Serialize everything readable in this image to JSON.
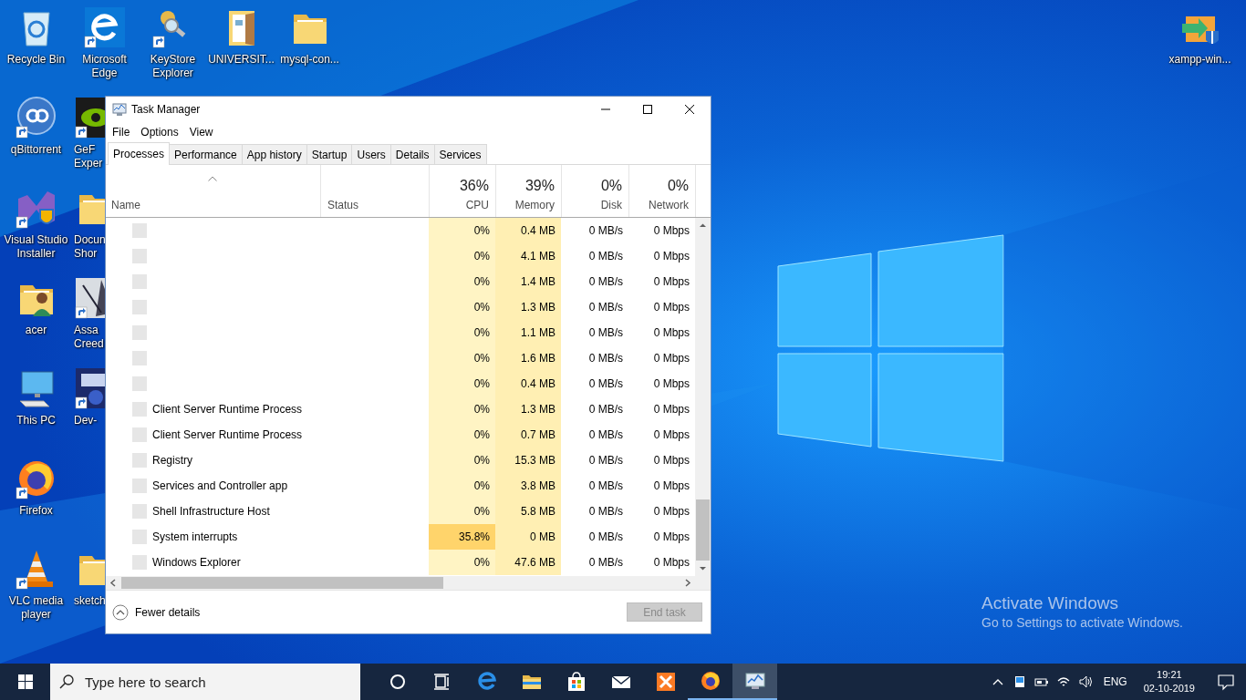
{
  "desktop": {
    "icons": [
      {
        "label": "Recycle Bin",
        "kind": "recycle-bin",
        "partial": false
      },
      {
        "label": "Microsoft Edge",
        "kind": "edge",
        "partial": false
      },
      {
        "label": "KeyStore Explorer",
        "kind": "keys",
        "partial": false
      },
      {
        "label": "UNIVERSIT...",
        "kind": "docs-folder",
        "partial": false
      },
      {
        "label": "mysql-con...",
        "kind": "folder",
        "partial": false
      },
      {
        "label": "xampp-win...",
        "kind": "xampp",
        "partial": false
      },
      {
        "label": "qBittorrent",
        "kind": "qbittorrent",
        "partial": false
      },
      {
        "label": "GeF Exper",
        "kind": "eye",
        "partial": true
      },
      {
        "label": "Visual Studio Installer",
        "kind": "vs",
        "partial": false
      },
      {
        "label": "Docun Shor",
        "kind": "folder",
        "partial": true
      },
      {
        "label": "acer",
        "kind": "user-folder",
        "partial": false
      },
      {
        "label": "Assa Creed",
        "kind": "game",
        "partial": true
      },
      {
        "label": "This PC",
        "kind": "pc",
        "partial": false
      },
      {
        "label": "Dev-",
        "kind": "devcpp",
        "partial": true
      },
      {
        "label": "Firefox",
        "kind": "firefox",
        "partial": false
      },
      {
        "label": "VLC media player",
        "kind": "vlc",
        "partial": false
      },
      {
        "label": "sketch",
        "kind": "folder",
        "partial": true
      }
    ],
    "activation_notice": {
      "title": "Activate Windows",
      "text": "Go to Settings to activate Windows."
    }
  },
  "task_manager": {
    "title": "Task Manager",
    "menu": [
      "File",
      "Options",
      "View"
    ],
    "tabs": [
      {
        "label": "Processes",
        "selected": true
      },
      {
        "label": "Performance",
        "selected": false
      },
      {
        "label": "App history",
        "selected": false
      },
      {
        "label": "Startup",
        "selected": false
      },
      {
        "label": "Users",
        "selected": false
      },
      {
        "label": "Details",
        "selected": false
      },
      {
        "label": "Services",
        "selected": false
      }
    ],
    "columns": [
      {
        "label": "Name",
        "sorted": true
      },
      {
        "label": "Status",
        "sorted": false
      },
      {
        "label": "CPU",
        "total": "36%",
        "color": "#fff4c4",
        "sorted": false
      },
      {
        "label": "Memory",
        "total": "39%",
        "color": "#ffefb3",
        "sorted": false
      },
      {
        "label": "Disk",
        "total": "0%",
        "color": "#ffffff",
        "sorted": false
      },
      {
        "label": "Network",
        "total": "0%",
        "color": "#ffffff",
        "sorted": false
      }
    ],
    "rows": [
      {
        "cpu": "0%",
        "memory": "0.4 MB",
        "disk": "0 MB/s",
        "network": "0 Mbps",
        "cpu_highlight": false
      },
      {
        "cpu": "0%",
        "memory": "4.1 MB",
        "disk": "0 MB/s",
        "network": "0 Mbps",
        "cpu_highlight": false
      },
      {
        "cpu": "0%",
        "memory": "1.4 MB",
        "disk": "0 MB/s",
        "network": "0 Mbps",
        "cpu_highlight": false
      },
      {
        "cpu": "0%",
        "memory": "1.3 MB",
        "disk": "0 MB/s",
        "network": "0 Mbps",
        "cpu_highlight": false
      },
      {
        "cpu": "0%",
        "memory": "1.1 MB",
        "disk": "0 MB/s",
        "network": "0 Mbps",
        "cpu_highlight": false
      },
      {
        "cpu": "0%",
        "memory": "1.6 MB",
        "disk": "0 MB/s",
        "network": "0 Mbps",
        "cpu_highlight": false
      },
      {
        "cpu": "0%",
        "memory": "0.4 MB",
        "disk": "0 MB/s",
        "network": "0 Mbps",
        "cpu_highlight": false
      },
      {
        "name": "Client Server Runtime Process",
        "cpu": "0%",
        "memory": "1.3 MB",
        "disk": "0 MB/s",
        "network": "0 Mbps",
        "cpu_highlight": false
      },
      {
        "name": "Client Server Runtime Process",
        "cpu": "0%",
        "memory": "0.7 MB",
        "disk": "0 MB/s",
        "network": "0 Mbps",
        "cpu_highlight": false
      },
      {
        "name": "Registry",
        "cpu": "0%",
        "memory": "15.3 MB",
        "disk": "0 MB/s",
        "network": "0 Mbps",
        "cpu_highlight": false
      },
      {
        "name": "Services and Controller app",
        "cpu": "0%",
        "memory": "3.8 MB",
        "disk": "0 MB/s",
        "network": "0 Mbps",
        "cpu_highlight": false
      },
      {
        "name": "Shell Infrastructure Host",
        "cpu": "0%",
        "memory": "5.8 MB",
        "disk": "0 MB/s",
        "network": "0 Mbps",
        "cpu_highlight": false
      },
      {
        "name": "System interrupts",
        "cpu": "35.8%",
        "memory": "0 MB",
        "disk": "0 MB/s",
        "network": "0 Mbps",
        "cpu_highlight": true
      },
      {
        "name": "Windows Explorer",
        "cpu": "0%",
        "memory": "47.6 MB",
        "disk": "0 MB/s",
        "network": "0 Mbps",
        "cpu_highlight": false
      }
    ],
    "footer": {
      "details_link": "Fewer details",
      "end_task": {
        "label": "End task",
        "disabled": true
      }
    }
  },
  "taskbar": {
    "search": {
      "placeholder": "Type here to search"
    },
    "apps": [
      {
        "kind": "cortana",
        "selected": false,
        "running": false
      },
      {
        "kind": "task-view",
        "selected": false,
        "running": false
      },
      {
        "kind": "edge",
        "selected": false,
        "running": false
      },
      {
        "kind": "folder",
        "selected": false,
        "running": false
      },
      {
        "kind": "store",
        "selected": false,
        "running": false
      },
      {
        "kind": "mail",
        "selected": false,
        "running": false
      },
      {
        "kind": "xampp",
        "selected": false,
        "running": false
      },
      {
        "kind": "firefox",
        "selected": false,
        "running": true
      },
      {
        "kind": "task-manager",
        "selected": true,
        "running": true
      }
    ],
    "tray": {
      "language": "ENG",
      "time": "19:21",
      "date": "02-10-2019"
    }
  }
}
